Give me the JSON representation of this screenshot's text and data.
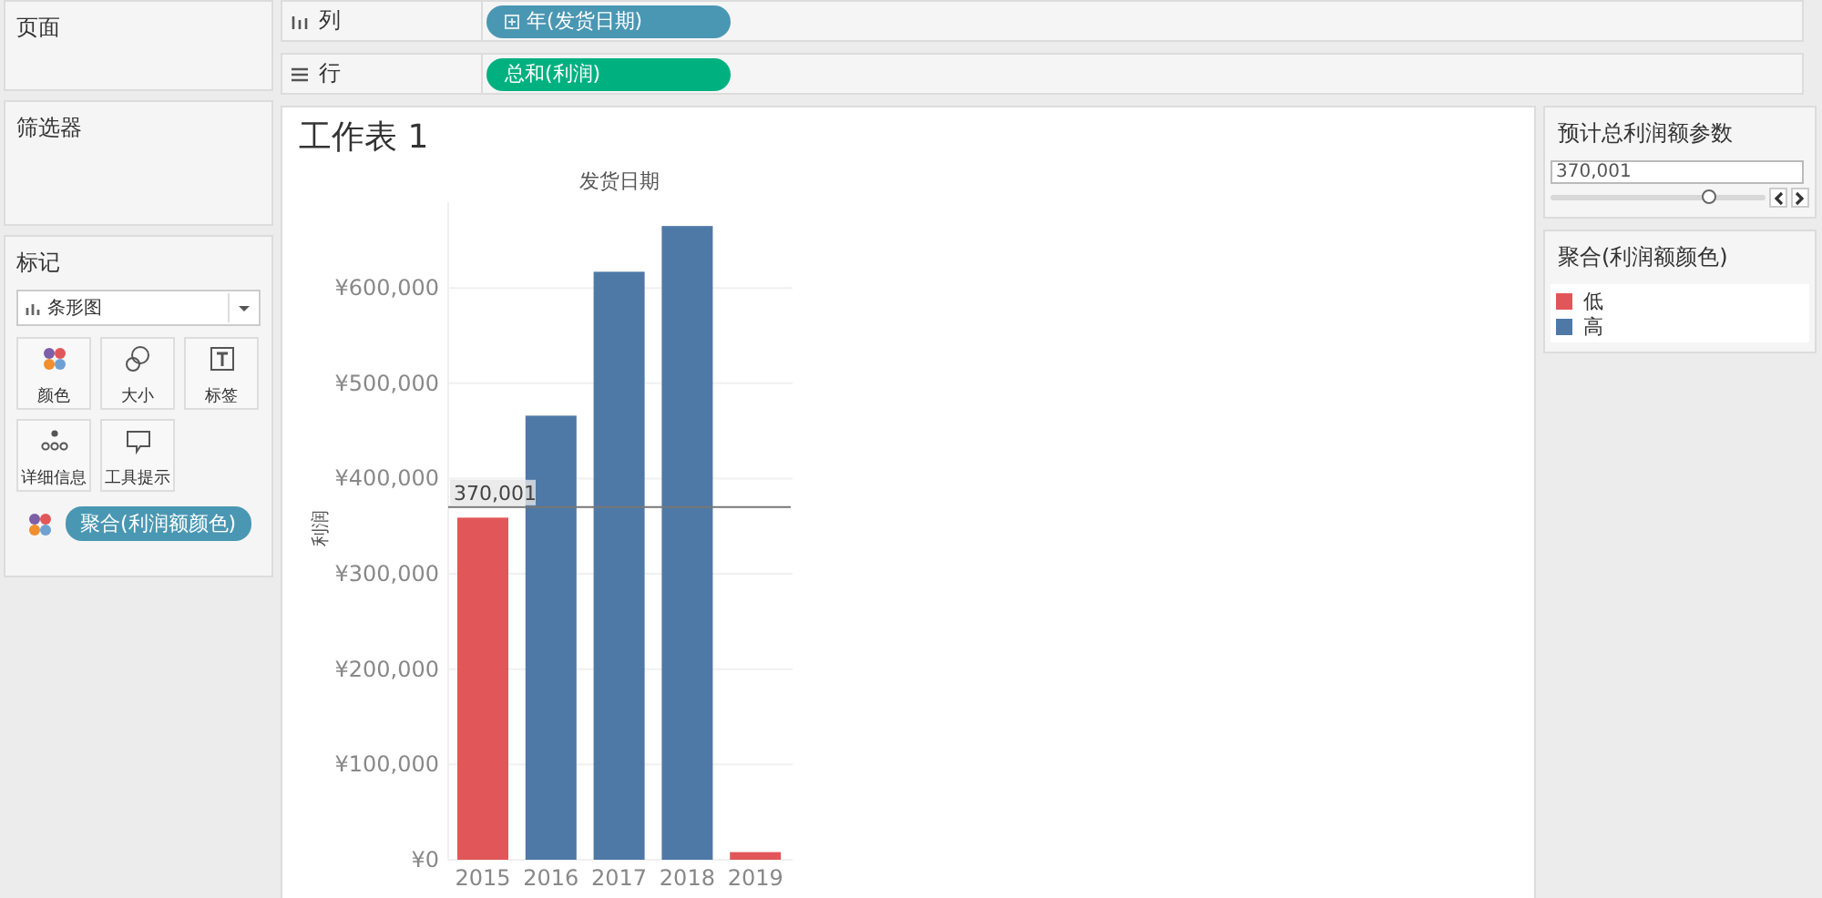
{
  "left": {
    "pages": {
      "title": "页面"
    },
    "filters": {
      "title": "筛选器"
    },
    "marks": {
      "title": "标记",
      "mark_type": "条形图",
      "cards": [
        {
          "label": "颜色",
          "kind": "color"
        },
        {
          "label": "大小",
          "kind": "size"
        },
        {
          "label": "标签",
          "kind": "label"
        },
        {
          "label": "详细信息",
          "kind": "detail"
        },
        {
          "label": "工具提示",
          "kind": "tooltip"
        }
      ],
      "pills": [
        {
          "label": "聚合(利润额颜色)",
          "kind": "color"
        }
      ]
    }
  },
  "shelves": [
    {
      "kind": "columns",
      "label": "列",
      "pill": {
        "label": "年(发货日期)",
        "color": "#4a97b3",
        "expandable": true
      }
    },
    {
      "kind": "rows",
      "label": "行",
      "pill": {
        "label": "总和(利润)",
        "color": "#00b180",
        "expandable": false
      }
    }
  ],
  "sheet": {
    "title": "工作表 1",
    "chart_data": {
      "type": "bar",
      "title": "发货日期",
      "ylabel": "利润",
      "categories": [
        "2015",
        "2016",
        "2017",
        "2018",
        "2019"
      ],
      "stacked": true,
      "series": [
        {
          "name": "低",
          "color": "#e15759",
          "values": [
            359000,
            null,
            null,
            null,
            8000
          ]
        },
        {
          "name": "高",
          "color": "#4e79a7",
          "values": [
            null,
            466000,
            617000,
            665000,
            null
          ]
        }
      ],
      "yticks": [
        {
          "value": 0,
          "label": "¥0"
        },
        {
          "value": 100000,
          "label": "¥100,000"
        },
        {
          "value": 200000,
          "label": "¥200,000"
        },
        {
          "value": 300000,
          "label": "¥300,000"
        },
        {
          "value": 400000,
          "label": "¥400,000"
        },
        {
          "value": 500000,
          "label": "¥500,000"
        },
        {
          "value": 600000,
          "label": "¥600,000"
        }
      ],
      "ylim": [
        0,
        690000
      ],
      "grid": true,
      "ref_lines": [
        {
          "axis": "y",
          "value": 370001,
          "label": "370,001"
        }
      ]
    }
  },
  "parameter": {
    "title": "预计总利润额参数",
    "value": "370,001",
    "level": 0.74
  },
  "legend": {
    "title": "聚合(利润额颜色)"
  }
}
